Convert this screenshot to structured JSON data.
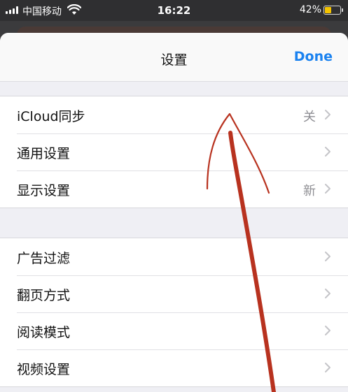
{
  "status_bar": {
    "carrier": "中国移动",
    "time": "16:22",
    "battery_percent": "42%",
    "battery_level": 0.42,
    "signal_icon": "signal-bars-icon",
    "wifi_icon": "wifi-icon",
    "battery_icon": "battery-icon"
  },
  "nav": {
    "title": "设置",
    "done_label": "Done"
  },
  "groups": [
    {
      "rows": [
        {
          "label": "iCloud同步",
          "value": "关"
        },
        {
          "label": "通用设置",
          "value": ""
        },
        {
          "label": "显示设置",
          "value": "新"
        }
      ]
    },
    {
      "rows": [
        {
          "label": "广告过滤",
          "value": ""
        },
        {
          "label": "翻页方式",
          "value": ""
        },
        {
          "label": "阅读模式",
          "value": ""
        },
        {
          "label": "视频设置",
          "value": ""
        }
      ]
    }
  ],
  "colors": {
    "accent": "#1a82f0",
    "annotation": "#b8321f",
    "background": "#efeff4"
  }
}
